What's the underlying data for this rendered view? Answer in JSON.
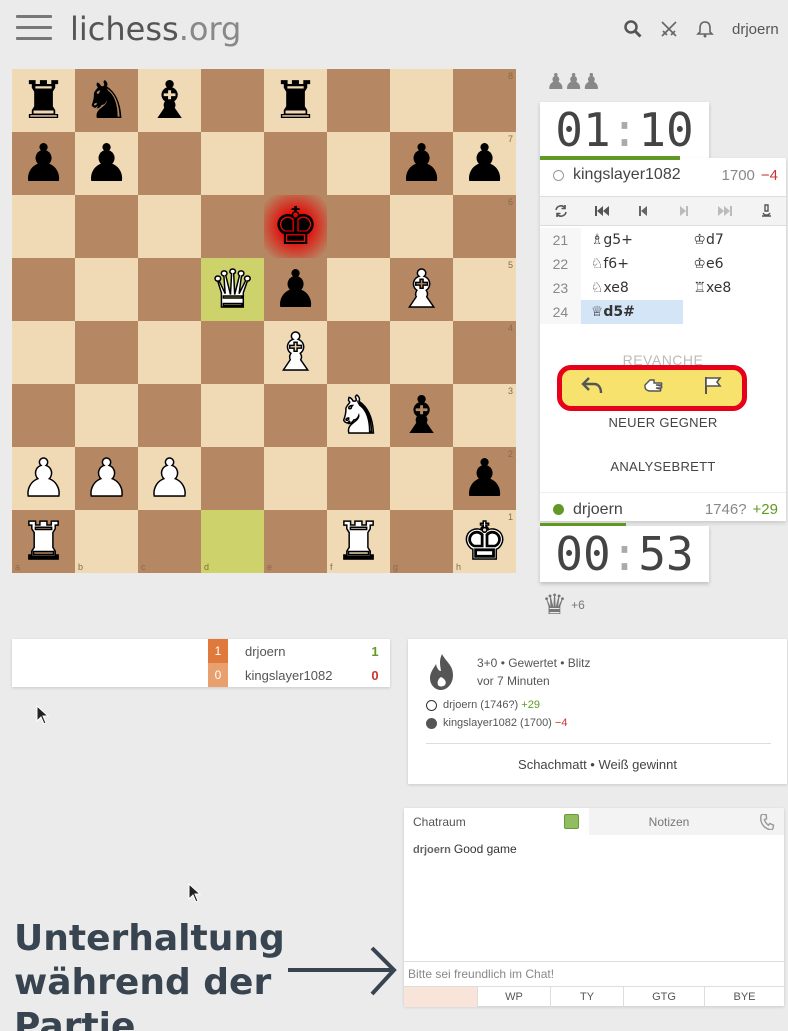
{
  "header": {
    "logo_main": "lichess",
    "logo_tld": ".org",
    "username": "drjoern",
    "icons": [
      "search-icon",
      "swords-icon",
      "bell-icon"
    ]
  },
  "board": {
    "files": [
      "a",
      "b",
      "c",
      "d",
      "e",
      "f",
      "g",
      "h"
    ],
    "ranks": [
      "8",
      "7",
      "6",
      "5",
      "4",
      "3",
      "2",
      "1"
    ],
    "squares": [
      [
        "bR",
        "bN",
        "bB",
        "",
        "bR",
        "",
        "",
        ""
      ],
      [
        "bP",
        "bP",
        "",
        "",
        "",
        "",
        "bP",
        "bP"
      ],
      [
        "",
        "",
        "",
        "",
        "bK",
        "",
        "",
        ""
      ],
      [
        "",
        "",
        "",
        "wQ",
        "bP",
        "",
        "wB",
        ""
      ],
      [
        "",
        "",
        "",
        "",
        "wB",
        "",
        "",
        ""
      ],
      [
        "",
        "",
        "",
        "",
        "",
        "wN",
        "bB",
        ""
      ],
      [
        "wP",
        "wP",
        "wP",
        "",
        "",
        "",
        "",
        "bP"
      ],
      [
        "wR",
        "",
        "",
        "",
        "",
        "wR",
        "",
        "wK"
      ]
    ],
    "last_move": [
      "d1",
      "d5"
    ],
    "check_square": "e6"
  },
  "opponent": {
    "material": "♟♟♟",
    "clock_min": "01",
    "clock_sec": "10",
    "name": "kingslayer1082",
    "rating": "1700",
    "diff": "−4",
    "time_fraction": 0.57
  },
  "me": {
    "name": "drjoern",
    "rating": "1746?",
    "diff": "+29",
    "clock_min": "00",
    "clock_sec": "53",
    "material_icon": "♛",
    "material_adv": "+6",
    "time_fraction": 0.35
  },
  "moves": [
    {
      "num": "21",
      "white": "♗g5+",
      "black": "♔d7"
    },
    {
      "num": "22",
      "white": "♘f6+",
      "black": "♔e6"
    },
    {
      "num": "23",
      "white": "♘xe8",
      "black": "♖xe8"
    },
    {
      "num": "24",
      "white": "♕d5#",
      "black": ""
    }
  ],
  "panel": {
    "rematch_label": "REVANCHE",
    "new_opponent_label": "NEUER GEGNER",
    "analysis_label": "ANALYSEBRETT"
  },
  "crosstable": {
    "rows": [
      {
        "box": "1",
        "name": "drjoern",
        "score": "1"
      },
      {
        "box": "0",
        "name": "kingslayer1082",
        "score": "0"
      }
    ]
  },
  "gameinfo": {
    "line1": "3+0 • Gewertet • Blitz",
    "line2": "vor 7 Minuten",
    "white_player": "drjoern (1746?)",
    "white_diff": "+29",
    "black_player": "kingslayer1082 (1700)",
    "black_diff": "−4",
    "result": "Schachmatt • Weiß gewinnt"
  },
  "chat": {
    "tab_chat": "Chatraum",
    "tab_notes": "Notizen",
    "message_user": "drjoern",
    "message_text": "Good game",
    "input_placeholder": "Bitte sei freundlich im Chat!",
    "presets": [
      "",
      "WP",
      "TY",
      "GTG",
      "BYE"
    ]
  },
  "annotation": {
    "line1": "Unterhaltung",
    "line2": "während der",
    "line3": "Partie"
  },
  "colors": {
    "accent_green": "#629924",
    "loss_red": "#cc3333",
    "highlight_red": "#e6001a",
    "highlight_yellow": "#f6e26d"
  }
}
